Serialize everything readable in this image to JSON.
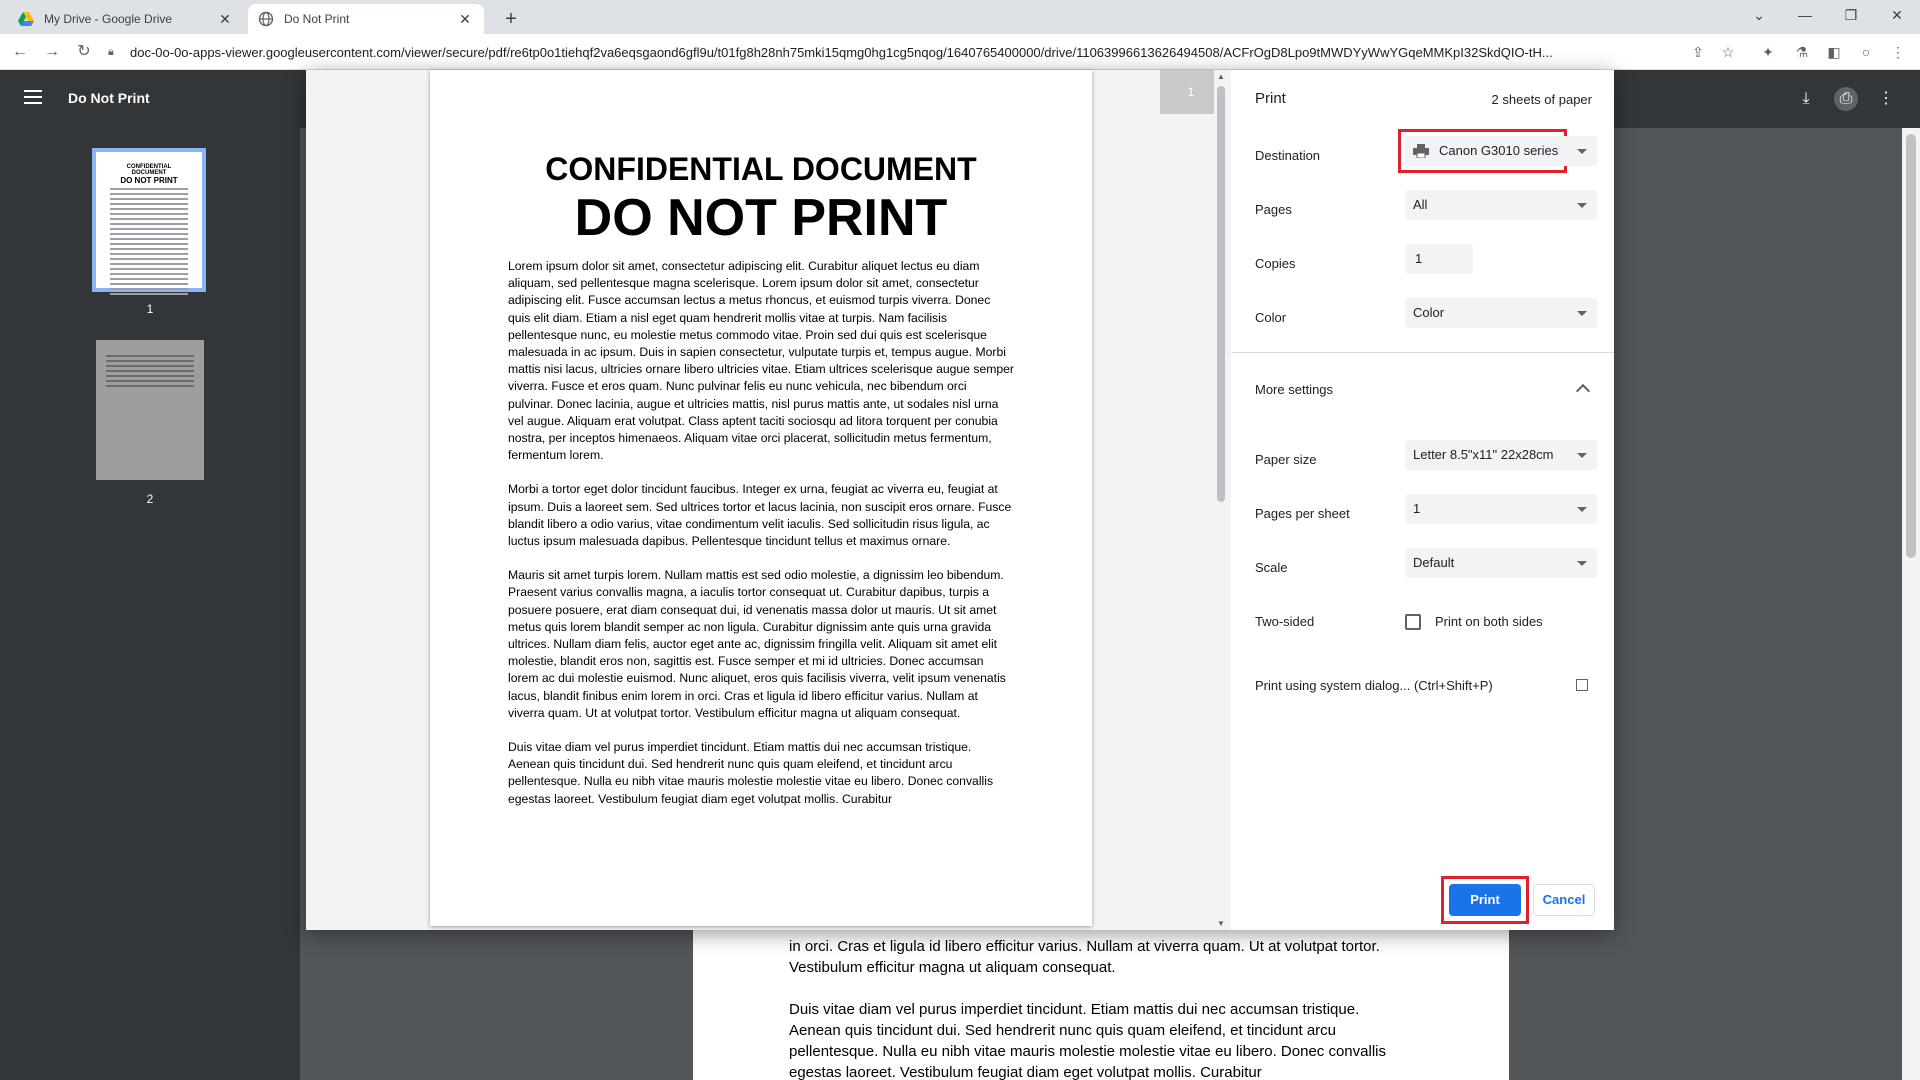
{
  "browser": {
    "tabs": [
      {
        "title": "My Drive - Google Drive",
        "active": false
      },
      {
        "title": "Do Not Print",
        "active": true
      }
    ],
    "url": "doc-0o-0o-apps-viewer.googleusercontent.com/viewer/secure/pdf/re6tp0o1tiehqf2va6eqsgaond6gfl9u/t01fg8h28nh75mki15qmg0hg1cg5nqog/1640765400000/drive/11063996613626494508/ACFrOgD8Lpo9tMWDYyWwYGqeMMKpI32SkdQIO-tH..."
  },
  "viewer": {
    "title": "Do Not Print",
    "thumbnails": [
      {
        "page": "1",
        "selected": true,
        "title1": "CONFIDENTIAL DOCUMENT",
        "title2": "DO NOT PRINT"
      },
      {
        "page": "2",
        "selected": false
      }
    ],
    "background_paragraphs": [
      "in orci. Cras et ligula id libero efficitur varius. Nullam at viverra quam. Ut at volutpat tortor. Vestibulum efficitur magna ut aliquam consequat.",
      "Duis vitae diam vel purus imperdiet tincidunt. Etiam mattis dui nec accumsan tristique. Aenean quis tincidunt dui. Sed hendrerit nunc quis quam eleifend, et tincidunt arcu pellentesque. Nulla eu nibh vitae mauris molestie molestie vitae eu libero. Donec convallis egestas laoreet. Vestibulum feugiat diam eget volutpat mollis. Curabitur"
    ]
  },
  "preview": {
    "page_indicator": "1",
    "heading1": "CONFIDENTIAL DOCUMENT",
    "heading2": "DO NOT PRINT",
    "paragraphs": [
      "Lorem ipsum dolor sit amet, consectetur adipiscing elit. Curabitur aliquet lectus eu diam aliquam, sed pellentesque magna scelerisque. Lorem ipsum dolor sit amet, consectetur adipiscing elit. Fusce accumsan lectus a metus rhoncus, et euismod turpis viverra. Donec quis elit diam. Etiam a nisl eget quam hendrerit mollis vitae at turpis. Nam facilisis pellentesque nunc, eu molestie metus commodo vitae. Proin sed dui quis est scelerisque malesuada in ac ipsum. Duis in sapien consectetur, vulputate turpis et, tempus augue. Morbi mattis nisi lacus, ultricies ornare libero ultricies vitae. Etiam ultrices scelerisque augue semper viverra. Fusce et eros quam. Nunc pulvinar felis eu nunc vehicula, nec bibendum orci pulvinar. Donec lacinia, augue et ultricies mattis, nisl purus mattis ante, ut sodales nisl urna vel augue. Aliquam erat volutpat. Class aptent taciti sociosqu ad litora torquent per conubia nostra, per inceptos himenaeos. Aliquam vitae orci placerat, sollicitudin metus fermentum, fermentum lorem.",
      "Morbi a tortor eget dolor tincidunt faucibus. Integer ex urna, feugiat ac viverra eu, feugiat at ipsum. Duis a laoreet sem. Sed ultrices tortor et lacus lacinia, non suscipit eros ornare. Fusce blandit libero a odio varius, vitae condimentum velit iaculis. Sed sollicitudin risus ligula, ac luctus ipsum malesuada dapibus. Pellentesque tincidunt tellus et maximus ornare.",
      "Mauris sit amet turpis lorem. Nullam mattis est sed odio molestie, a dignissim leo bibendum. Praesent varius convallis magna, a iaculis tortor consequat ut. Curabitur dapibus, turpis a posuere posuere, erat diam consequat dui, id venenatis massa dolor ut mauris. Ut sit amet metus quis lorem blandit semper ac non ligula. Curabitur dignissim ante quis urna gravida ultrices. Nullam diam felis, auctor eget ante ac, dignissim fringilla velit. Aliquam sit amet elit molestie, blandit eros non, sagittis est. Fusce semper et mi id ultricies. Donec accumsan lorem ac dui molestie euismod. Nunc aliquet, eros quis facilisis viverra, velit ipsum venenatis lacus, blandit finibus enim lorem in orci. Cras et ligula id libero efficitur varius. Nullam at viverra quam. Ut at volutpat tortor. Vestibulum efficitur magna ut aliquam consequat.",
      "Duis vitae diam vel purus imperdiet tincidunt. Etiam mattis dui nec accumsan tristique. Aenean quis tincidunt dui. Sed hendrerit nunc quis quam eleifend, et tincidunt arcu pellentesque. Nulla eu nibh vitae mauris molestie molestie vitae eu libero. Donec convallis egestas laoreet. Vestibulum feugiat diam eget volutpat mollis. Curabitur"
    ]
  },
  "print": {
    "title": "Print",
    "sheets": "2 sheets of paper",
    "destination": {
      "label": "Destination",
      "value": "Canon G3010 series"
    },
    "pages": {
      "label": "Pages",
      "value": "All"
    },
    "copies": {
      "label": "Copies",
      "value": "1"
    },
    "color": {
      "label": "Color",
      "value": "Color"
    },
    "more_settings": "More settings",
    "paper_size": {
      "label": "Paper size",
      "value": "Letter 8.5\"x11\" 22x28cm"
    },
    "pages_per_sheet": {
      "label": "Pages per sheet",
      "value": "1"
    },
    "scale": {
      "label": "Scale",
      "value": "Default"
    },
    "two_sided": {
      "label": "Two-sided",
      "option": "Print on both sides",
      "checked": false
    },
    "system_dialog": "Print using system dialog... (Ctrl+Shift+P)",
    "print_button": "Print",
    "cancel_button": "Cancel"
  },
  "colors": {
    "accent": "#1a73e8",
    "highlight": "#e0202e",
    "viewer_bg": "#323639"
  },
  "icons": [
    "drive-icon",
    "globe-icon",
    "close-icon",
    "plus-icon",
    "back-icon",
    "forward-icon",
    "reload-icon",
    "lock-icon",
    "share-icon",
    "star-icon",
    "extensions-icon",
    "lab-icon",
    "sidepanel-icon",
    "profile-icon",
    "kebab-icon",
    "hamburger-icon",
    "download-icon",
    "printer-icon",
    "chevron-up-icon",
    "external-link-icon"
  ]
}
